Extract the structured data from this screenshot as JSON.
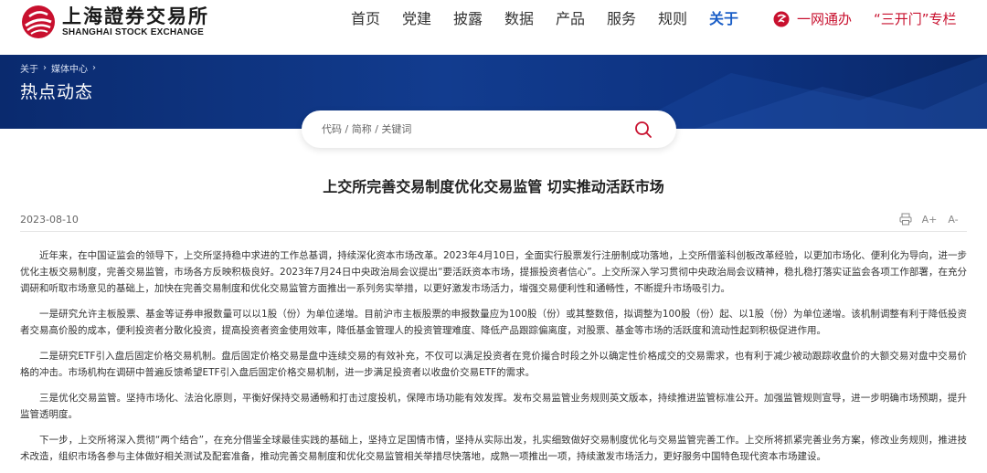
{
  "header": {
    "logo_cn": "上海證券交易所",
    "logo_en": "SHANGHAI STOCK EXCHANGE",
    "nav": [
      "首页",
      "党建",
      "披露",
      "数据",
      "产品",
      "服务",
      "规则",
      "关于"
    ],
    "active_nav": "关于",
    "yiwang_label": "一网通办",
    "sankaimen_label": "“三开门”专栏"
  },
  "banner": {
    "breadcrumb": [
      "关于",
      "媒体中心"
    ],
    "title": "热点动态"
  },
  "search": {
    "placeholder": "代码 / 简称 / 关键词",
    "value": ""
  },
  "article": {
    "title": "上交所完善交易制度优化交易监管 切实推动活跃市场",
    "date": "2023-08-10",
    "tools": {
      "font_increase": "A+",
      "font_decrease": "A-"
    },
    "paragraphs": [
      "近年来，在中国证监会的领导下，上交所坚持稳中求进的工作总基调，持续深化资本市场改革。2023年4月10日，全面实行股票发行注册制成功落地，上交所借鉴科创板改革经验，以更加市场化、便利化为导向，进一步优化主板交易制度，完善交易监管，市场各方反映积极良好。2023年7月24日中央政治局会议提出“要活跃资本市场，提振投资者信心”。上交所深入学习贯彻中央政治局会议精神，稳扎稳打落实证监会各项工作部署，在充分调研和听取市场意见的基础上，加快在完善交易制度和优化交易监管方面推出一系列务实举措，以更好激发市场活力，增强交易便利性和通畅性，不断提升市场吸引力。",
      "一是研究允许主板股票、基金等证券申报数量可以以1股（份）为单位递增。目前沪市主板股票的申报数量应为100股（份）或其整数倍，拟调整为100股（份）起、以1股（份）为单位递增。该机制调整有利于降低投资者交易高价股的成本，便利投资者分散化投资，提高投资者资金使用效率，降低基金管理人的投资管理难度、降低产品跟踪偏离度，对股票、基金等市场的活跃度和流动性起到积极促进作用。",
      "二是研究ETF引入盘后固定价格交易机制。盘后固定价格交易是盘中连续交易的有效补充，不仅可以满足投资者在竞价撮合时段之外以确定性价格成交的交易需求，也有利于减少被动跟踪收盘价的大额交易对盘中交易价格的冲击。市场机构在调研中普遍反馈希望ETF引入盘后固定价格交易机制，进一步满足投资者以收盘价交易ETF的需求。",
      "三是优化交易监管。坚持市场化、法治化原则，平衡好保持交易通畅和打击过度投机，保障市场功能有效发挥。发布交易监管业务规则英文版本，持续推进监管标准公开。加强监管规则宣导，进一步明确市场预期，提升监管透明度。",
      "下一步，上交所将深入贯彻“两个结合”，在充分借鉴全球最佳实践的基础上，坚持立足国情市情，坚持从实际出发，扎实细致做好交易制度优化与交易监管完善工作。上交所将抓紧完善业务方案，修改业务规则，推进技术改造，组织市场各参与主体做好相关测试及配套准备，推动完善交易制度和优化交易监管相关举措尽快落地，成熟一项推出一项，持续激发市场活力，更好服务中国特色现代资本市场建设。"
    ]
  },
  "colors": {
    "brand_red": "#c8102e",
    "active_blue": "#1a5ec7",
    "banner_blue": "#123c8f"
  }
}
